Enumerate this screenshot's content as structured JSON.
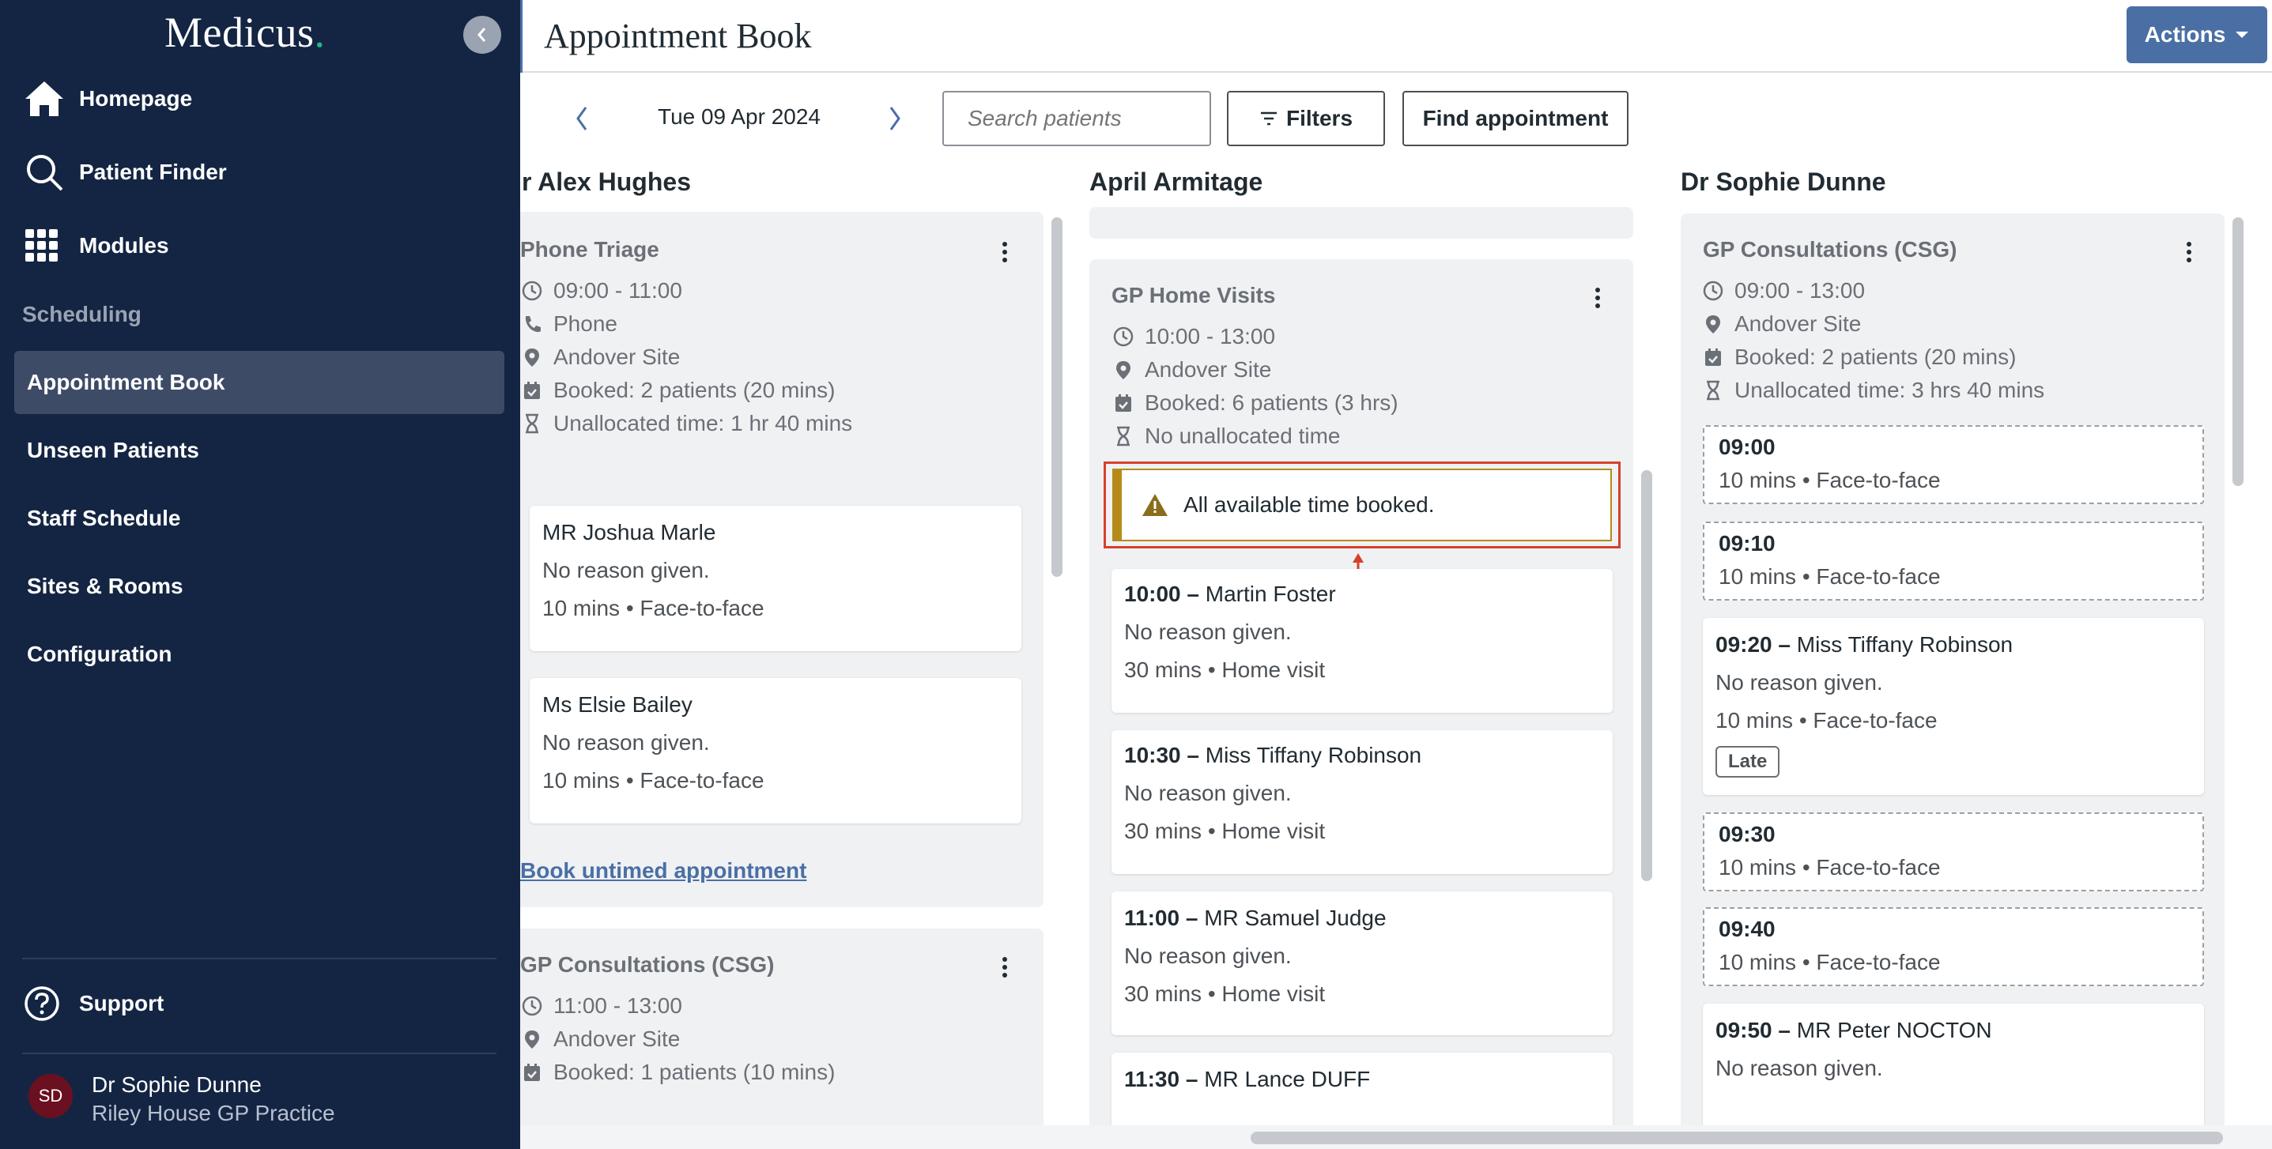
{
  "sidebar": {
    "logo_text": "Medicus",
    "logo_dot": ".",
    "nav": [
      {
        "label": "Homepage",
        "icon": "home-icon"
      },
      {
        "label": "Patient Finder",
        "icon": "search-icon"
      },
      {
        "label": "Modules",
        "icon": "grid-icon"
      }
    ],
    "section_title": "Scheduling",
    "items": [
      {
        "label": "Appointment Book",
        "active": true
      },
      {
        "label": "Unseen Patients"
      },
      {
        "label": "Staff Schedule"
      },
      {
        "label": "Sites & Rooms"
      },
      {
        "label": "Configuration"
      }
    ],
    "support_label": "Support",
    "user": {
      "initials": "SD",
      "name": "Dr Sophie Dunne",
      "practice": "Riley House GP Practice"
    }
  },
  "header": {
    "title": "Appointment Book",
    "actions_label": "Actions"
  },
  "toolbar": {
    "date": "Tue 09 Apr 2024",
    "search_placeholder": "Search patients",
    "filters_label": "Filters",
    "find_label": "Find appointment"
  },
  "columns": [
    {
      "name": "r Alex Hughes",
      "sessions": [
        {
          "title": "Phone Triage",
          "time": "09:00 - 11:00",
          "type": "Phone",
          "site": "Andover Site",
          "booked": "Booked: 2 patients (20 mins)",
          "unallocated": "Unallocated time: 1 hr 40 mins",
          "cards": [
            {
              "name": "MR Joshua Marle",
              "reason": "No reason given.",
              "detail": "10 mins • Face-to-face"
            },
            {
              "name": "Ms Elsie Bailey",
              "reason": "No reason given.",
              "detail": "10 mins • Face-to-face"
            }
          ],
          "link": "Book untimed appointment"
        },
        {
          "title": "GP Consultations (CSG)",
          "time": "11:00 - 13:00",
          "site": "Andover Site",
          "booked": "Booked: 1 patients (10 mins)"
        }
      ]
    },
    {
      "name": "April Armitage",
      "sessions": [
        {
          "title": "GP Home Visits",
          "time": "10:00 - 13:00",
          "site": "Andover Site",
          "booked": "Booked: 6 patients (3 hrs)",
          "unallocated": "No unallocated time",
          "alert": "All available time booked.",
          "cards": [
            {
              "time": "10:00 –",
              "name": "Martin Foster",
              "reason": "No reason given.",
              "detail": "30 mins • Home visit"
            },
            {
              "time": "10:30 –",
              "name": "Miss Tiffany Robinson",
              "reason": "No reason given.",
              "detail": "30 mins • Home visit"
            },
            {
              "time": "11:00 –",
              "name": "MR Samuel Judge",
              "reason": "No reason given.",
              "detail": "30 mins • Home visit"
            },
            {
              "time": "11:30 –",
              "name": "MR Lance DUFF"
            }
          ]
        }
      ]
    },
    {
      "name": "Dr Sophie Dunne",
      "sessions": [
        {
          "title": "GP Consultations (CSG)",
          "time": "09:00 - 13:00",
          "site": "Andover Site",
          "booked": "Booked: 2 patients (20 mins)",
          "unallocated": "Unallocated time: 3 hrs 40 mins",
          "slots": [
            {
              "time": "09:00",
              "detail": "10 mins • Face-to-face"
            },
            {
              "time": "09:10",
              "detail": "10 mins • Face-to-face"
            },
            {
              "time": "09:30",
              "detail": "10 mins • Face-to-face"
            },
            {
              "time": "09:40",
              "detail": "10 mins • Face-to-face"
            }
          ],
          "cards": [
            {
              "time": "09:20 –",
              "name": "Miss Tiffany Robinson",
              "reason": "No reason given.",
              "detail": "10 mins • Face-to-face",
              "badge": "Late"
            },
            {
              "time": "09:50 –",
              "name": "MR Peter NOCTON",
              "reason": "No reason given."
            }
          ]
        }
      ]
    }
  ],
  "colors": {
    "sidebar_bg": "#142543",
    "accent": "#4a6fa5",
    "alert_border": "#b58a18",
    "highlight": "#d6402c"
  }
}
